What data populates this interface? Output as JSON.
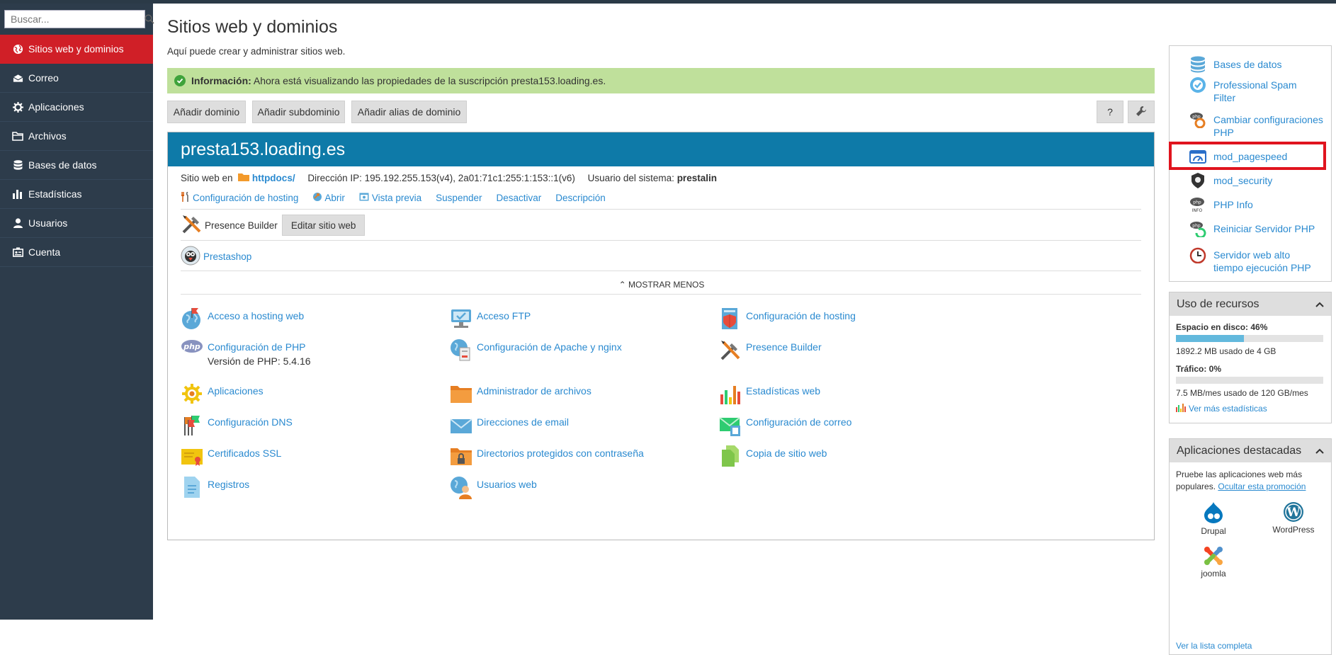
{
  "search": {
    "placeholder": "Buscar..."
  },
  "sidebar": {
    "items": [
      {
        "label": "Sitios web y dominios",
        "icon": "globe-icon",
        "active": true
      },
      {
        "label": "Correo",
        "icon": "envelope-icon"
      },
      {
        "label": "Aplicaciones",
        "icon": "gear-icon"
      },
      {
        "label": "Archivos",
        "icon": "folder-icon"
      },
      {
        "label": "Bases de datos",
        "icon": "database-icon"
      },
      {
        "label": "Estadísticas",
        "icon": "bar-chart-icon"
      },
      {
        "label": "Usuarios",
        "icon": "user-icon"
      },
      {
        "label": "Cuenta",
        "icon": "id-card-icon"
      }
    ]
  },
  "page": {
    "title": "Sitios web y dominios",
    "subtitle": "Aquí puede crear y administrar sitios web.",
    "info_label": "Información:",
    "info_text": " Ahora está visualizando las propiedades de la suscripción presta153.loading.es."
  },
  "toolbar": {
    "add_domain": "Añadir dominio",
    "add_subdomain": "Añadir subdominio",
    "add_alias": "Añadir alias de dominio",
    "help": "?",
    "tools_icon": "wrench-icon"
  },
  "domain": {
    "name": "presta153.loading.es",
    "site_prefix": "Sitio web en ",
    "docroot": "httpdocs/",
    "ip_label": "Dirección IP: ",
    "ip_value": "195.192.255.153(v4), 2a01:71c1:255:1:153::1(v6)",
    "user_label": "Usuario del sistema: ",
    "user_value": "prestalin",
    "actions": [
      "Configuración de hosting",
      "Abrir",
      "Vista previa",
      "Suspender",
      "Desactivar",
      "Descripción"
    ],
    "presence_builder": "Presence Builder",
    "edit_site": "Editar sitio web",
    "prestashop": "Prestashop",
    "show_less": "MOSTRAR MENOS"
  },
  "tools": [
    [
      "Acceso a hosting web",
      "Acceso FTP",
      "Configuración de hosting"
    ],
    [
      "Configuración de PHP",
      "Configuración de Apache y nginx",
      "Presence Builder"
    ],
    [
      "Aplicaciones",
      "Administrador de archivos",
      "Estadísticas web"
    ],
    [
      "Configuración DNS",
      "Direcciones de email",
      "Configuración de correo"
    ],
    [
      "Certificados SSL",
      "Directorios protegidos con contraseña",
      "Copia de sitio web"
    ],
    [
      "Registros",
      "Usuarios web",
      ""
    ]
  ],
  "php_version": "Versión de PHP: 5.4.16",
  "right_tools": [
    {
      "label": "Bases de datos",
      "icon": "database-icon"
    },
    {
      "label": "Professional Spam Filter",
      "icon": "spam-filter-icon"
    },
    {
      "label": "Cambiar configuraciones PHP",
      "icon": "php-settings-icon"
    },
    {
      "label": "mod_pagespeed",
      "icon": "pagespeed-icon"
    },
    {
      "label": "mod_security",
      "icon": "security-icon"
    },
    {
      "label": "PHP Info",
      "icon": "php-info-icon"
    },
    {
      "label": "Reiniciar Servidor PHP",
      "icon": "php-restart-icon"
    },
    {
      "label": "Servidor web alto tiempo ejecución PHP",
      "icon": "clock-icon"
    }
  ],
  "resources": {
    "title": "Uso de recursos",
    "disk_label": "Espacio en disco: 46%",
    "disk_percent": 46,
    "disk_detail": "1892.2 MB usado de 4 GB",
    "traffic_label": "Tráfico: 0%",
    "traffic_percent": 0,
    "traffic_detail": "7.5 MB/mes usado de 120 GB/mes",
    "more_stats": "Ver más estadísticas"
  },
  "featured": {
    "title": "Aplicaciones destacadas",
    "text": "Pruebe las aplicaciones web más populares. ",
    "hide": "Ocultar esta promoción",
    "apps": [
      "Drupal",
      "WordPress",
      "joomla"
    ],
    "full_list": "Ver la lista completa"
  },
  "colors": {
    "accent": "#d01f27",
    "header": "#0e7aa8",
    "sidebar": "#2d3c4b",
    "info": "#bfe09b",
    "link": "#2a8ad0"
  }
}
